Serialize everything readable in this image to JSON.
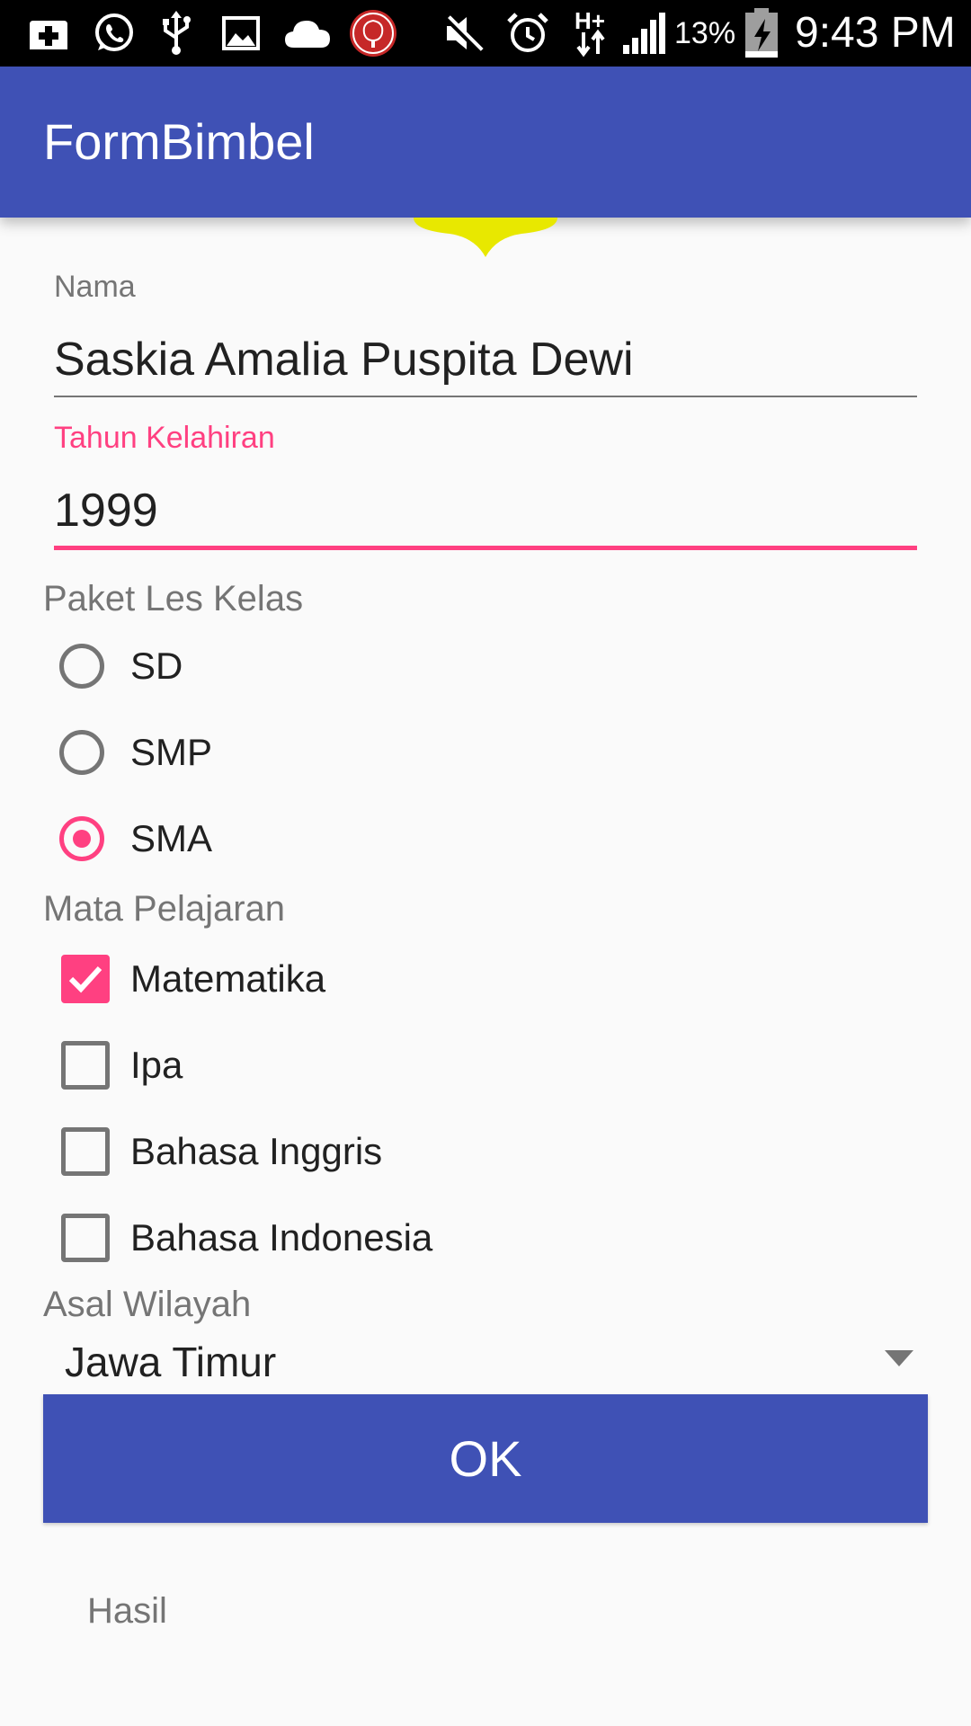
{
  "status_bar": {
    "battery": "13%",
    "time": "9:43 PM",
    "icons": [
      "plus-icon",
      "whatsapp-icon",
      "usb-icon",
      "image-icon",
      "cloud-icon",
      "rp-badge-icon",
      "mute-icon",
      "alarm-icon",
      "h-plus-data-icon",
      "signal-icon",
      "battery-charging-icon"
    ]
  },
  "app_bar": {
    "title": "FormBimbel"
  },
  "form": {
    "nama": {
      "label": "Nama",
      "value": "Saskia Amalia Puspita Dewi"
    },
    "tahun": {
      "label": "Tahun Kelahiran",
      "value": "1999",
      "focused": true
    },
    "paket": {
      "label": "Paket Les Kelas",
      "options": [
        {
          "label": "SD",
          "checked": false
        },
        {
          "label": "SMP",
          "checked": false
        },
        {
          "label": "SMA",
          "checked": true
        }
      ]
    },
    "mapel": {
      "label": "Mata Pelajaran",
      "options": [
        {
          "label": "Matematika",
          "checked": true
        },
        {
          "label": "Ipa",
          "checked": false
        },
        {
          "label": "Bahasa Inggris",
          "checked": false
        },
        {
          "label": "Bahasa Indonesia",
          "checked": false
        }
      ]
    },
    "wilayah": {
      "label": "Asal Wilayah",
      "selected": "Jawa Timur"
    },
    "ok_button": "OK",
    "result": "Hasil"
  },
  "colors": {
    "primary": "#3f51b5",
    "accent": "#ff4081",
    "status_bar": "#000000",
    "background": "#fafafa",
    "edge_glow": "#e8e800"
  }
}
